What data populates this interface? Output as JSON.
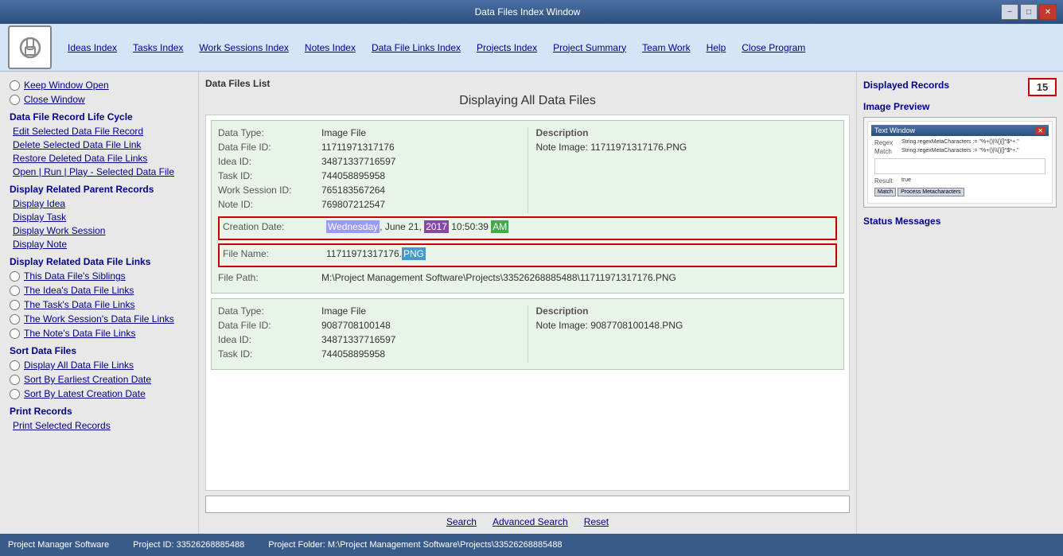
{
  "titleBar": {
    "title": "Data Files Index Window",
    "minimize": "−",
    "restore": "□",
    "close": "✕"
  },
  "menuBar": {
    "logo": "🔒",
    "items": [
      {
        "label": "Ideas Index",
        "name": "menu-ideas-index"
      },
      {
        "label": "Tasks Index",
        "name": "menu-tasks-index"
      },
      {
        "label": "Work Sessions Index",
        "name": "menu-work-sessions-index"
      },
      {
        "label": "Notes Index",
        "name": "menu-notes-index"
      },
      {
        "label": "Data File Links Index",
        "name": "menu-data-file-links-index"
      },
      {
        "label": "Projects Index",
        "name": "menu-projects-index"
      },
      {
        "label": "Project Summary",
        "name": "menu-project-summary"
      },
      {
        "label": "Team Work",
        "name": "menu-team-work"
      },
      {
        "label": "Help",
        "name": "menu-help"
      },
      {
        "label": "Close Program",
        "name": "menu-close-program"
      }
    ]
  },
  "sidebar": {
    "keepWindowOpen": "Keep Window Open",
    "closeWindow": "Close Window",
    "dataFileRecordLifeCycleTitle": "Data File Record Life Cycle",
    "editSelectedDataFileRecord": "Edit Selected Data File Record",
    "deleteSelectedDataFileLink": "Delete Selected Data File Link",
    "restoreDeletedDataFileLinks": "Restore Deleted Data File Links",
    "openRunPlaySelectedDataFile": "Open | Run | Play - Selected Data File",
    "displayRelatedParentRecordsTitle": "Display Related Parent Records",
    "displayIdea": "Display Idea",
    "displayTask": "Display Task",
    "displayWorkSession": "Display Work Session",
    "displayNote": "Display Note",
    "displayRelatedDataFileLinksTitle": "Display Related Data File Links",
    "thisDataFilesSiblings": "This Data File's Siblings",
    "theIdeasDataFileLinks": "The Idea's Data File Links",
    "theTasksDataFileLinks": "The Task's Data File Links",
    "theWorkSessionsDataFileLinks": "The Work Session's Data File Links",
    "theNotesDataFileLinks": "The Note's Data File Links",
    "sortDataFilesTitle": "Sort Data Files",
    "displayAllDataFileLinks": "Display All Data File Links",
    "sortByEarliestCreationDate": "Sort By Earliest Creation Date",
    "sortByLatestCreationDate": "Sort By Latest Creation Date",
    "printRecordsTitle": "Print Records",
    "printSelectedRecords": "Print Selected Records"
  },
  "content": {
    "listTitle": "Data Files List",
    "displayingTitle": "Displaying All Data Files",
    "records": [
      {
        "dataType": {
          "label": "Data Type:",
          "value": "Image File"
        },
        "dataFileId": {
          "label": "Data File ID:",
          "value": "11711971317176"
        },
        "ideaId": {
          "label": "Idea ID:",
          "value": "34871337716597"
        },
        "taskId": {
          "label": "Task ID:",
          "value": "744058895958"
        },
        "workSessionId": {
          "label": "Work Session ID:",
          "value": "765183567264"
        },
        "noteId": {
          "label": "Note ID:",
          "value": "769807212547"
        },
        "description": {
          "label": "Description",
          "value": "Note Image: 11711971317176.PNG"
        },
        "creationDate": {
          "label": "Creation Date:",
          "value": "Wednesday, June 21, 2017",
          "time": "10:50:39 AM"
        },
        "fileName": {
          "label": "File Name:",
          "value": "11711971317176.",
          "ext": "PNG"
        },
        "filePath": {
          "label": "File Path:",
          "value": "M:\\Project Management Software\\Projects\\33526268885488\\11711971317176.PNG"
        },
        "highlighted": true
      },
      {
        "dataType": {
          "label": "Data Type:",
          "value": "Image File"
        },
        "dataFileId": {
          "label": "Data File ID:",
          "value": "9087708100148"
        },
        "ideaId": {
          "label": "Idea ID:",
          "value": "34871337716597"
        },
        "taskId": {
          "label": "Task ID:",
          "value": "744058895958"
        },
        "description": {
          "label": "Description",
          "value": "Note Image: 9087708100148.PNG"
        },
        "highlighted": false
      }
    ],
    "searchBar": {
      "placeholder": "",
      "searchLabel": "Search",
      "advancedSearchLabel": "Advanced Search",
      "resetLabel": "Reset"
    }
  },
  "rightPanel": {
    "displayedRecordsTitle": "Displayed Records",
    "recordsCount": "15",
    "imagePreviewTitle": "Image Preview",
    "preview": {
      "windowTitle": "Text Window",
      "regexLabel": "Regex",
      "regexValue": "String.regexMetaCharacters := \"%+()|\\\\{}[]^$*+.\"",
      "matchLabel": "Match",
      "matchValue": "String.regexMetaCharacters := \"%+()|\\\\{}[]^$*+.\"",
      "resultLabel": "Result",
      "resultValue": "true",
      "matchBtn": "Match",
      "processBtn": "Process Metacharacters"
    },
    "statusMessagesTitle": "Status Messages"
  },
  "statusBar": {
    "appName": "Project Manager Software",
    "projectId": "Project ID:  33526268885488",
    "projectFolder": "Project Folder: M:\\Project Management Software\\Projects\\33526268885488"
  }
}
